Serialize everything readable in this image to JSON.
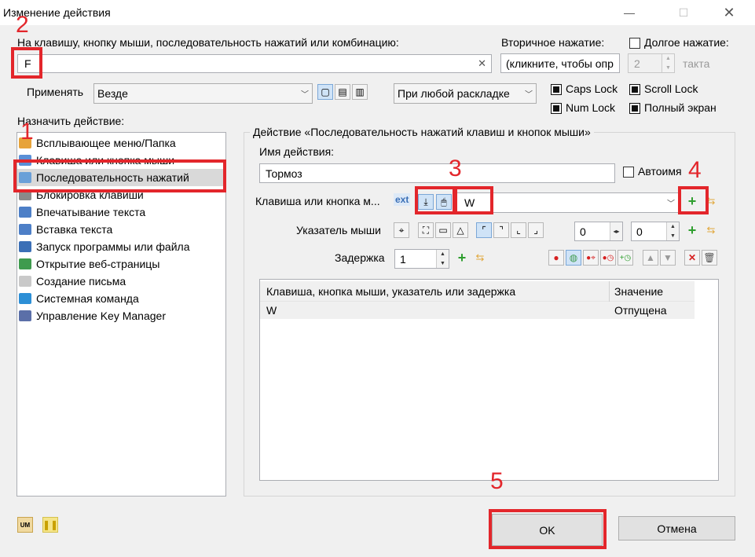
{
  "window": {
    "title": "Изменение действия",
    "minimize_glyph": "—",
    "maximize_glyph": "☐",
    "close_glyph": "✕"
  },
  "hotkey": {
    "label": "На клавишу, кнопку мыши, последовательность нажатий или комбинацию:",
    "value": "F",
    "clear_glyph": "✕"
  },
  "secondary": {
    "label": "Вторичное нажатие:",
    "value": "(кликните, чтобы опр"
  },
  "long_press": {
    "label": "Долгое нажатие:",
    "value": "2",
    "unit": "такта"
  },
  "apply": {
    "label": "Применять",
    "value": "Везде",
    "layout_value": "При любой раскладке"
  },
  "locks": {
    "caps": "Caps Lock",
    "num": "Num Lock",
    "scroll": "Scroll Lock",
    "fullscreen": "Полный экран"
  },
  "assign": {
    "label": "Назначить действие:",
    "items": [
      {
        "label": "Всплывающее меню/Папка",
        "icon": "menu-folder-icon",
        "color": "#e7a33a"
      },
      {
        "label": "Клавиша или кнопка мыши",
        "icon": "key-mouse-icon",
        "color": "#5a8fd6"
      },
      {
        "label": "Последовательность нажатий",
        "icon": "sequence-icon",
        "color": "#6aa0d8"
      },
      {
        "label": "Блокировка клавиши",
        "icon": "lock-icon",
        "color": "#8a8a8a"
      },
      {
        "label": "Впечатывание текста",
        "icon": "typing-icon",
        "color": "#4d7fc7"
      },
      {
        "label": "Вставка текста",
        "icon": "paste-icon",
        "color": "#4d7fc7"
      },
      {
        "label": "Запуск программы или файла",
        "icon": "run-program-icon",
        "color": "#3b6fb6"
      },
      {
        "label": "Открытие веб-страницы",
        "icon": "globe-icon",
        "color": "#3f9b4e"
      },
      {
        "label": "Создание письма",
        "icon": "mail-icon",
        "color": "#c9c9c9"
      },
      {
        "label": "Системная команда",
        "icon": "monitor-icon",
        "color": "#2c8fd6"
      },
      {
        "label": "Управление Key Manager",
        "icon": "key-manager-icon",
        "color": "#5b6fa8"
      }
    ]
  },
  "action": {
    "group_title": "Действие «Последовательность нажатий клавиш и кнопок мыши»",
    "name_label": "Имя действия:",
    "name_value": "Тормоз",
    "autoname": "Автоимя",
    "key_label": "Клавиша или кнопка м...",
    "ext_label": "ext",
    "key_value": "W",
    "pointer_label": "Указатель мыши",
    "pointer_x": "0",
    "pointer_y": "0",
    "delay_label": "Задержка",
    "delay_value": "1",
    "table": {
      "headers": [
        "Клавиша, кнопка мыши, указатель или задержка",
        "Значение"
      ],
      "rows": [
        {
          "key": "W",
          "value": "Отпущена"
        }
      ]
    }
  },
  "footer": {
    "ok": "OK",
    "cancel": "Отмена"
  },
  "annotations": [
    "1",
    "2",
    "3",
    "4",
    "5"
  ],
  "colors": {
    "annotation_red": "#e3262b",
    "selection": "#d9d9d9",
    "add_green": "#2e9e2e"
  }
}
